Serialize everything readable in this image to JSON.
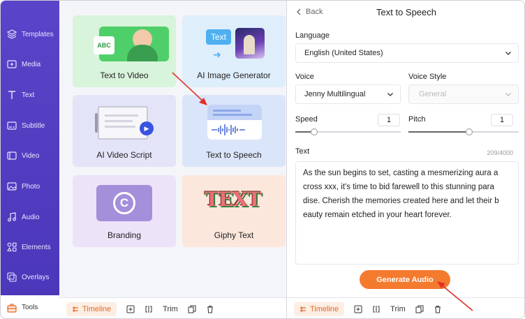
{
  "sidebar": {
    "items": [
      {
        "label": "Templates",
        "icon": "layers-icon"
      },
      {
        "label": "Media",
        "icon": "media-icon"
      },
      {
        "label": "Text",
        "icon": "text-icon"
      },
      {
        "label": "Subtitle",
        "icon": "subtitle-icon"
      },
      {
        "label": "Video",
        "icon": "video-icon"
      },
      {
        "label": "Photo",
        "icon": "photo-icon"
      },
      {
        "label": "Audio",
        "icon": "music-icon"
      },
      {
        "label": "Elements",
        "icon": "elements-icon"
      },
      {
        "label": "Overlays",
        "icon": "overlays-icon"
      }
    ],
    "tools_label": "Tools"
  },
  "tools": {
    "cards": [
      {
        "label": "Text to Video"
      },
      {
        "label": "AI Image Generator",
        "art_text": "Text"
      },
      {
        "label": "AI Video Script"
      },
      {
        "label": "Text to Speech"
      },
      {
        "label": "Branding"
      },
      {
        "label": "Giphy Text",
        "art_text": "TEXT"
      }
    ],
    "art_abc": "ABC"
  },
  "toolbar": {
    "timeline": "Timeline",
    "trim": "Trim"
  },
  "tts": {
    "back": "Back",
    "title": "Text to Speech",
    "language_label": "Language",
    "language_value": "English (United States)",
    "voice_label": "Voice",
    "voice_value": "Jenny Multilingual",
    "voice_style_label": "Voice Style",
    "voice_style_value": "General",
    "speed_label": "Speed",
    "speed_value": "1",
    "pitch_label": "Pitch",
    "pitch_value": "1",
    "speed_level": 0.18,
    "pitch_level": 0.55,
    "text_label": "Text",
    "text_counter": "209/4000",
    "text_lines": [
      "As the sun begins to set, casting a mesmerizing aura a",
      "cross xxx, it's time to bid farewell to this stunning para",
      "dise. Cherish the memories created here and let their b",
      "eauty remain etched in your heart forever."
    ],
    "generate_label": "Generate Audio"
  },
  "colors": {
    "sidebar": "#5340c4",
    "accent": "#f47a2e",
    "arrow": "#e0302a"
  }
}
